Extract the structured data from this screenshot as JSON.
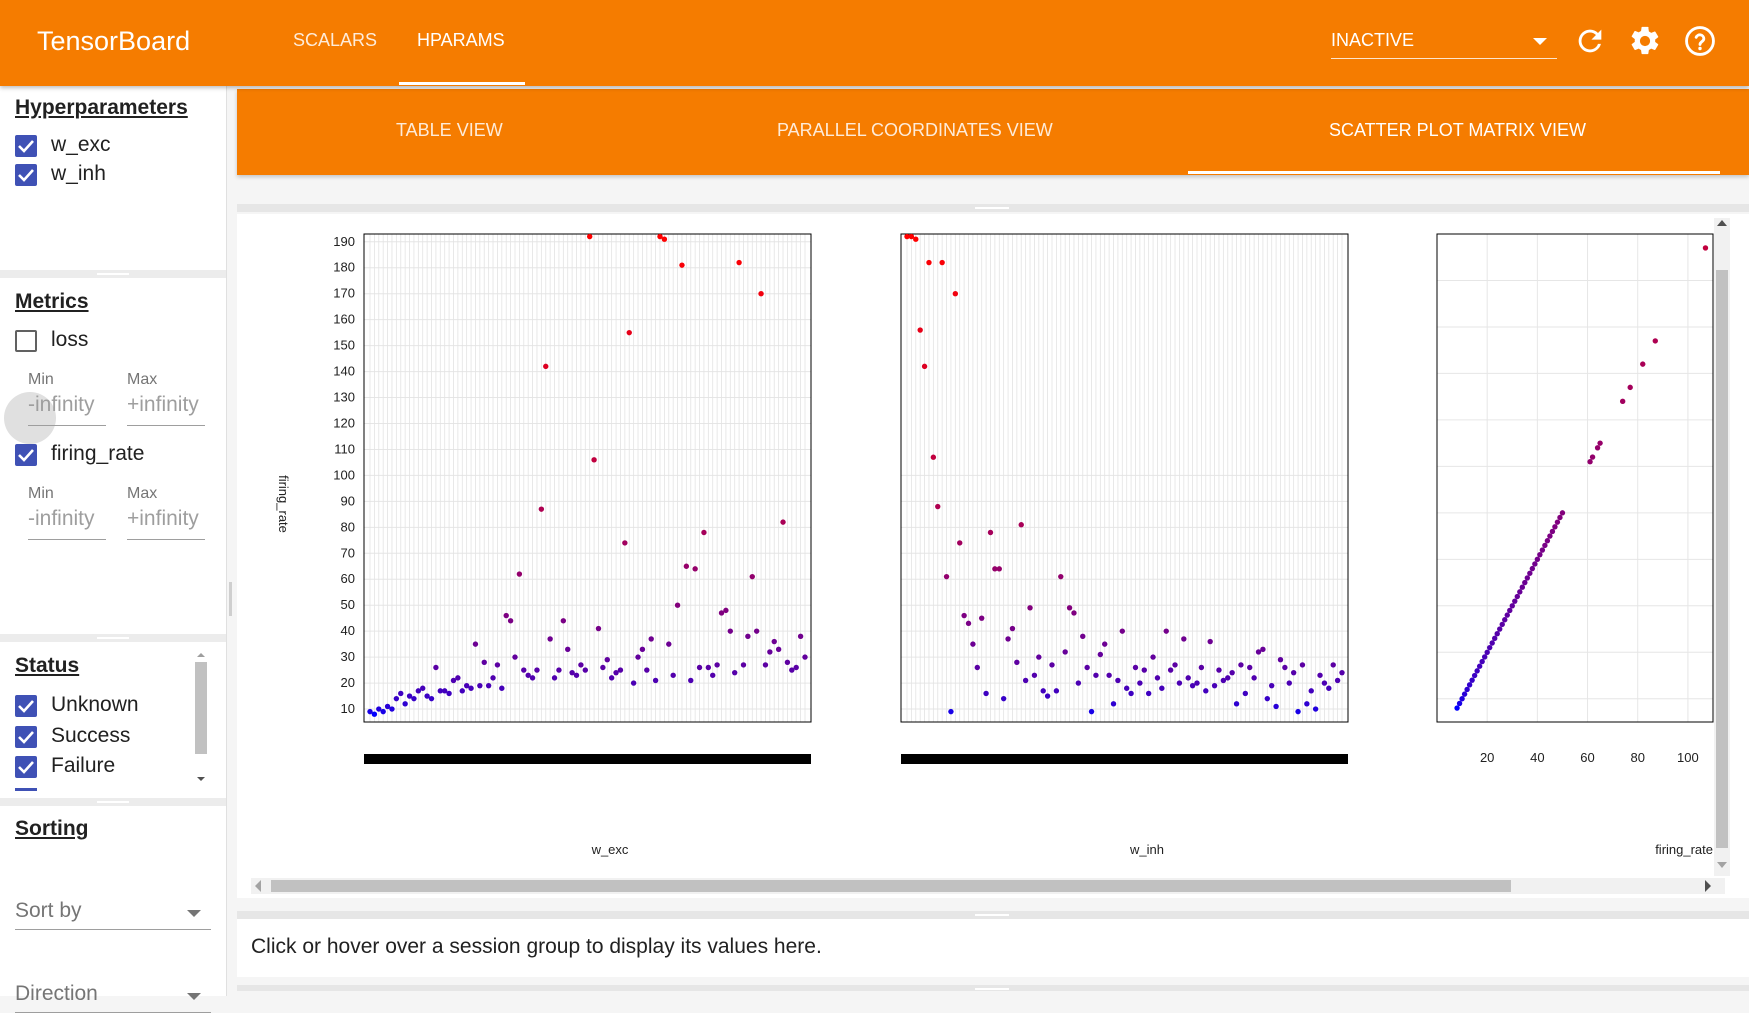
{
  "app": {
    "title": "TensorBoard"
  },
  "nav": {
    "tabs": [
      "SCALARS",
      "HPARAMS"
    ],
    "active": "HPARAMS"
  },
  "run_select": {
    "value": "INACTIVE"
  },
  "icons": {
    "reload": "reload-icon",
    "settings": "gear-icon",
    "help": "help-icon"
  },
  "colors": {
    "accent": "#f57c00",
    "checkbox": "#3f51b5"
  },
  "hparams": {
    "title": "Hyperparameters",
    "items": [
      {
        "label": "w_exc",
        "checked": true
      },
      {
        "label": "w_inh",
        "checked": true
      }
    ]
  },
  "metrics": {
    "title": "Metrics",
    "items": [
      {
        "label": "loss",
        "checked": false,
        "min_label": "Min",
        "max_label": "Max",
        "min": "-infinity",
        "max": "+infinity"
      },
      {
        "label": "firing_rate",
        "checked": true,
        "min_label": "Min",
        "max_label": "Max",
        "min": "-infinity",
        "max": "+infinity"
      }
    ]
  },
  "status": {
    "title": "Status",
    "items": [
      {
        "label": "Unknown",
        "checked": true
      },
      {
        "label": "Success",
        "checked": true
      },
      {
        "label": "Failure",
        "checked": true
      }
    ]
  },
  "sorting": {
    "title": "Sorting",
    "sort_by": "Sort by",
    "direction": "Direction"
  },
  "views": {
    "tabs": [
      "TABLE VIEW",
      "PARALLEL COORDINATES VIEW",
      "SCATTER PLOT MATRIX VIEW"
    ],
    "active": "SCATTER PLOT MATRIX VIEW"
  },
  "info_text": "Click or hover over a session group to display its values here.",
  "chart_data": [
    {
      "type": "scatter",
      "xlabel": "w_exc",
      "ylabel": "firing_rate",
      "ylim": [
        5,
        193
      ],
      "yticks": [
        10,
        20,
        30,
        40,
        50,
        60,
        70,
        80,
        90,
        100,
        110,
        120,
        130,
        140,
        150,
        160,
        170,
        180,
        190
      ],
      "grid": true,
      "x_ticks_dense": true,
      "color_scale": "blue-to-red by firing_rate",
      "x_index": [
        1,
        2,
        3,
        4,
        5,
        6,
        7,
        8,
        9,
        10,
        11,
        12,
        13,
        14,
        15,
        16,
        17,
        18,
        19,
        20,
        21,
        22,
        23,
        24,
        25,
        26,
        27,
        28,
        29,
        30,
        31,
        32,
        33,
        34,
        35,
        36,
        37,
        38,
        39,
        40,
        41,
        42,
        43,
        44,
        45,
        46,
        47,
        48,
        49,
        50,
        51,
        52,
        53,
        54,
        55,
        56,
        57,
        58,
        59,
        60,
        61,
        62,
        63,
        64,
        65,
        66,
        67,
        68,
        69,
        70,
        71,
        72,
        73,
        74,
        75,
        76,
        77,
        78,
        79,
        80,
        81,
        82,
        83,
        84,
        85,
        86,
        87,
        88,
        89,
        90,
        91,
        92,
        93,
        94,
        95,
        96,
        97,
        98,
        99,
        100
      ],
      "y": [
        9,
        8,
        10,
        9,
        11,
        10,
        14,
        16,
        12,
        15,
        14,
        17,
        18,
        15,
        14,
        26,
        17,
        17,
        16,
        21,
        22,
        17,
        19,
        18,
        35,
        19,
        28,
        19,
        22,
        27,
        18,
        46,
        44,
        30,
        62,
        25,
        23,
        22,
        25,
        87,
        142,
        37,
        22,
        25,
        44,
        33,
        24,
        23,
        27,
        25,
        192,
        106,
        41,
        26,
        29,
        22,
        24,
        25,
        74,
        155,
        20,
        30,
        33,
        25,
        37,
        21,
        192,
        191,
        35,
        23,
        50,
        181,
        65,
        21,
        64,
        26,
        78,
        26,
        23,
        27,
        47,
        48,
        40,
        24,
        182,
        27,
        38,
        61,
        40,
        170,
        27,
        32,
        36,
        33,
        82,
        28,
        25,
        26,
        38,
        30
      ]
    },
    {
      "type": "scatter",
      "xlabel": "w_inh",
      "ylabel": "",
      "ylim": [
        5,
        193
      ],
      "grid": true,
      "x_ticks_dense": true,
      "x_index": [
        1,
        2,
        3,
        4,
        5,
        6,
        7,
        8,
        9,
        10,
        11,
        12,
        13,
        14,
        15,
        16,
        17,
        18,
        19,
        20,
        21,
        22,
        23,
        24,
        25,
        26,
        27,
        28,
        29,
        30,
        31,
        32,
        33,
        34,
        35,
        36,
        37,
        38,
        39,
        40,
        41,
        42,
        43,
        44,
        45,
        46,
        47,
        48,
        49,
        50,
        51,
        52,
        53,
        54,
        55,
        56,
        57,
        58,
        59,
        60,
        61,
        62,
        63,
        64,
        65,
        66,
        67,
        68,
        69,
        70,
        71,
        72,
        73,
        74,
        75,
        76,
        77,
        78,
        79,
        80,
        81,
        82,
        83,
        84,
        85,
        86,
        87,
        88,
        89,
        90,
        91,
        92,
        93,
        94,
        95,
        96,
        97,
        98,
        99,
        100
      ],
      "y": [
        192,
        192,
        191,
        156,
        142,
        182,
        107,
        88,
        182,
        61,
        9,
        170,
        74,
        46,
        43,
        35,
        26,
        45,
        16,
        78,
        64,
        64,
        14,
        37,
        41,
        28,
        81,
        21,
        49,
        23,
        30,
        17,
        15,
        27,
        17,
        61,
        32,
        49,
        47,
        20,
        38,
        26,
        9,
        23,
        31,
        35,
        23,
        12,
        21,
        40,
        18,
        16,
        26,
        20,
        25,
        16,
        30,
        22,
        18,
        40,
        25,
        27,
        20,
        37,
        22,
        19,
        20,
        26,
        17,
        36,
        19,
        25,
        21,
        22,
        24,
        12,
        27,
        16,
        26,
        22,
        32,
        33,
        14,
        19,
        11,
        29,
        26,
        20,
        24,
        9,
        27,
        12,
        17,
        10,
        23,
        20,
        18,
        27,
        21,
        24
      ]
    },
    {
      "type": "scatter",
      "xlabel": "firing_rate",
      "ylabel": "",
      "ylim": [
        5,
        110
      ],
      "xlim": [
        0,
        110
      ],
      "xticks": [
        20,
        40,
        60,
        80,
        100
      ],
      "grid": true,
      "x": [
        8,
        9,
        10,
        11,
        12,
        13,
        14,
        15,
        16,
        17,
        18,
        19,
        20,
        21,
        22,
        23,
        24,
        25,
        26,
        27,
        28,
        29,
        30,
        31,
        32,
        33,
        34,
        35,
        36,
        37,
        38,
        39,
        40,
        41,
        42,
        43,
        44,
        45,
        46,
        47,
        48,
        49,
        50,
        61,
        62,
        64,
        65,
        74,
        77,
        82,
        87,
        107
      ],
      "y": [
        8,
        9,
        10,
        11,
        12,
        13,
        14,
        15,
        16,
        17,
        18,
        19,
        20,
        21,
        22,
        23,
        24,
        25,
        26,
        27,
        28,
        29,
        30,
        31,
        32,
        33,
        34,
        35,
        36,
        37,
        38,
        39,
        40,
        41,
        42,
        43,
        44,
        45,
        46,
        47,
        48,
        49,
        50,
        61,
        62,
        64,
        65,
        74,
        77,
        82,
        87,
        107
      ]
    }
  ]
}
